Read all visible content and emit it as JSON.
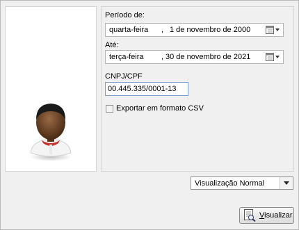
{
  "form": {
    "periodo_label": "Período de:",
    "periodo": {
      "weekday": "quarta-feira",
      "sep": ",",
      "date": "1 de novembro de 2000"
    },
    "ate_label": "Até:",
    "ate": {
      "weekday": "terça-feira",
      "sep": ",",
      "date": "30 de novembro de 2021"
    },
    "cnpj_label": "CNPJ/CPF",
    "cnpj_value": "00.445.335/0001-13",
    "export_label": "Exportar em formato CSV",
    "export_checked": false
  },
  "view_select": {
    "selected": "Visualização Normal"
  },
  "action": {
    "button_first": "V",
    "button_rest": "isualizar"
  },
  "icons": {
    "calendar": "calendar-dropdown-icon",
    "avatar": "user-avatar-icon",
    "visualizar": "document-view-icon"
  },
  "colors": {
    "skin": "#6b4226",
    "hair": "#1a1a1a",
    "collar": "#c8342c"
  }
}
